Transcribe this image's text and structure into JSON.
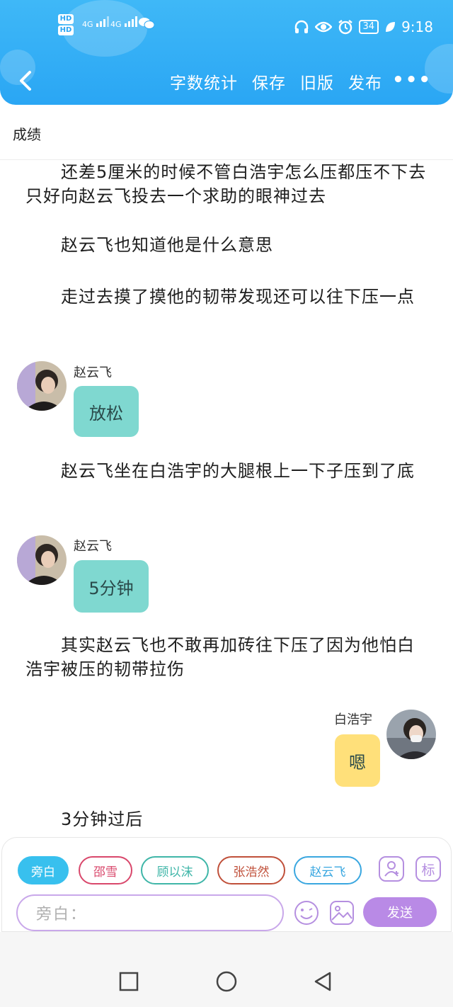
{
  "status_bar": {
    "hd1": "HD",
    "hd2": "HD",
    "net1": "4G",
    "net2": "4G",
    "battery": "34",
    "time": "9:18",
    "icons": [
      "headset-icon",
      "eye-icon",
      "alarm-icon",
      "battery-icon",
      "leaf-icon"
    ]
  },
  "toolbar": {
    "items": [
      "字数统计",
      "保存",
      "旧版",
      "发布"
    ],
    "more": "•••"
  },
  "page": {
    "title": "成绩"
  },
  "story": [
    {
      "type": "narration",
      "text": "还差5厘米的时候不管白浩宇怎么压都压不下去只好向赵云飞投去一个求助的眼神过去"
    },
    {
      "type": "narration",
      "text": "赵云飞也知道他是什么意思"
    },
    {
      "type": "narration",
      "text": "走过去摸了摸他的韧带发现还可以往下压一点"
    },
    {
      "type": "dialogue",
      "speaker": "赵云飞",
      "text": "放松",
      "side": "left"
    },
    {
      "type": "narration",
      "text": "赵云飞坐在白浩宇的大腿根上一下子压到了底"
    },
    {
      "type": "dialogue",
      "speaker": "赵云飞",
      "text": "5分钟",
      "side": "left"
    },
    {
      "type": "narration",
      "text": "其实赵云飞也不敢再加砖往下压了因为他怕白浩宇被压的韧带拉伤"
    },
    {
      "type": "dialogue",
      "speaker": "白浩宇",
      "text": "嗯",
      "side": "right"
    },
    {
      "type": "narration",
      "text": "3分钟过后"
    }
  ],
  "characters": [
    "旁白",
    "邵雪",
    "顾以沫",
    "张浩然",
    "赵云飞"
  ],
  "input": {
    "placeholder": "旁白：",
    "send_label": "发送",
    "tag_label": "标"
  },
  "colors": {
    "header": "#2aa6f4",
    "narrator_chip": "#38c0ee",
    "left_bubble": "#7fd8d0",
    "right_bubble": "#ffe07a",
    "accent_purple": "#b98ae6",
    "chip_red": "#d9476b",
    "chip_teal": "#3fb6a8",
    "chip_brown": "#c0503a",
    "chip_blue": "#3aa7e0"
  }
}
